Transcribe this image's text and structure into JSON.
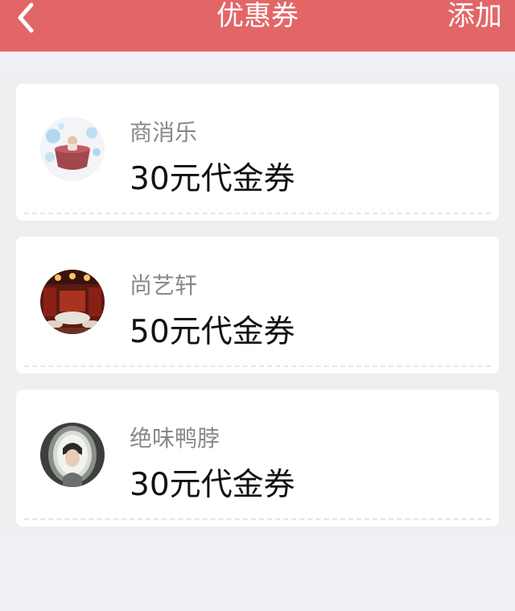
{
  "navbar": {
    "back_icon": "chevron-left-icon",
    "title": "优惠券",
    "action_label": "添加",
    "background_color": "#e36667"
  },
  "coupons": [
    {
      "store_name": "商消乐",
      "value_label": "30元代金券",
      "avatar": "store-photo-bathtub"
    },
    {
      "store_name": "尚艺轩",
      "value_label": "50元代金券",
      "avatar": "store-photo-restaurant"
    },
    {
      "store_name": "绝味鸭脖",
      "value_label": "30元代金券",
      "avatar": "store-photo-portrait"
    }
  ]
}
